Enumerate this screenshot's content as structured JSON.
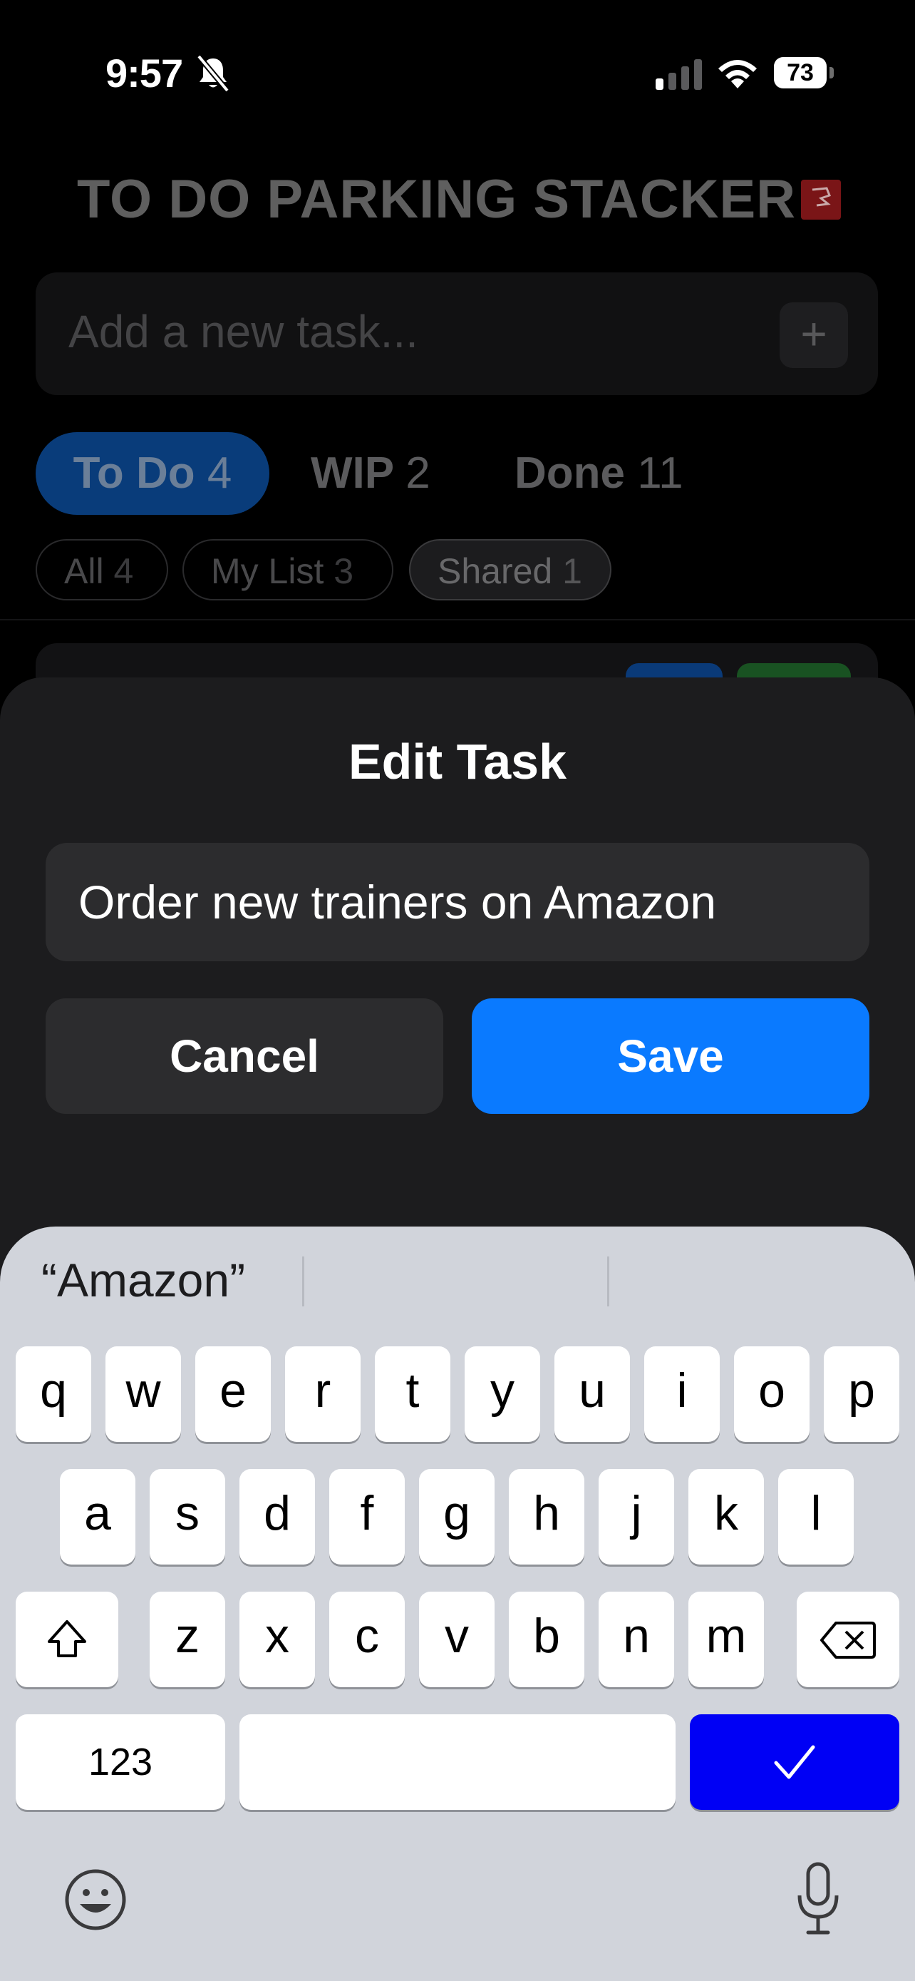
{
  "status_bar": {
    "time": "9:57",
    "battery": "73"
  },
  "app": {
    "title": "TO DO PARKING STACKER",
    "input_placeholder": "Add a new task...",
    "add_button": "+",
    "tabs": [
      {
        "label": "To Do",
        "count": "4"
      },
      {
        "label": "WIP",
        "count": "2"
      },
      {
        "label": "Done",
        "count": "11"
      }
    ],
    "filters": [
      {
        "label": "All",
        "count": "4"
      },
      {
        "label": "My List",
        "count": "3"
      },
      {
        "label": "Shared",
        "count": "1"
      }
    ]
  },
  "sheet": {
    "title": "Edit Task",
    "field_value": "Order new trainers on Amazon",
    "cancel_label": "Cancel",
    "save_label": "Save"
  },
  "keyboard": {
    "suggestions": [
      "“Amazon”",
      "",
      ""
    ],
    "rows": [
      [
        "q",
        "w",
        "e",
        "r",
        "t",
        "y",
        "u",
        "i",
        "o",
        "p"
      ],
      [
        "a",
        "s",
        "d",
        "f",
        "g",
        "h",
        "j",
        "k",
        "l"
      ],
      [
        "z",
        "x",
        "c",
        "v",
        "b",
        "n",
        "m"
      ]
    ],
    "numbers_label": "123",
    "done_label": "✓"
  },
  "colors": {
    "accent": "#0A7AFF",
    "done_key": "#0000F5",
    "sheet": "#1C1C1E",
    "keyboard": "#D1D4DB"
  }
}
